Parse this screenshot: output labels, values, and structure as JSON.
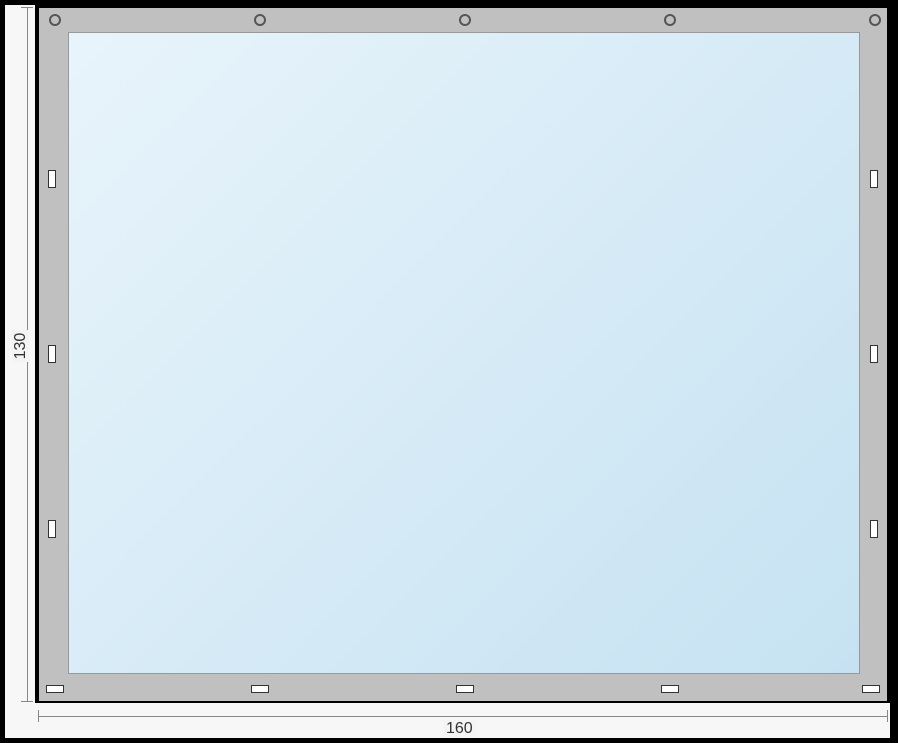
{
  "dimensions": {
    "height_label": "130",
    "width_label": "160"
  },
  "frame": {
    "border_color": "#c0c0c0",
    "panel_gradient_start": "#e8f4fb",
    "panel_gradient_end": "#c6e2f2"
  },
  "holes_top_count": 5,
  "slots_side_count_each": 3,
  "slots_bottom_count": 5
}
